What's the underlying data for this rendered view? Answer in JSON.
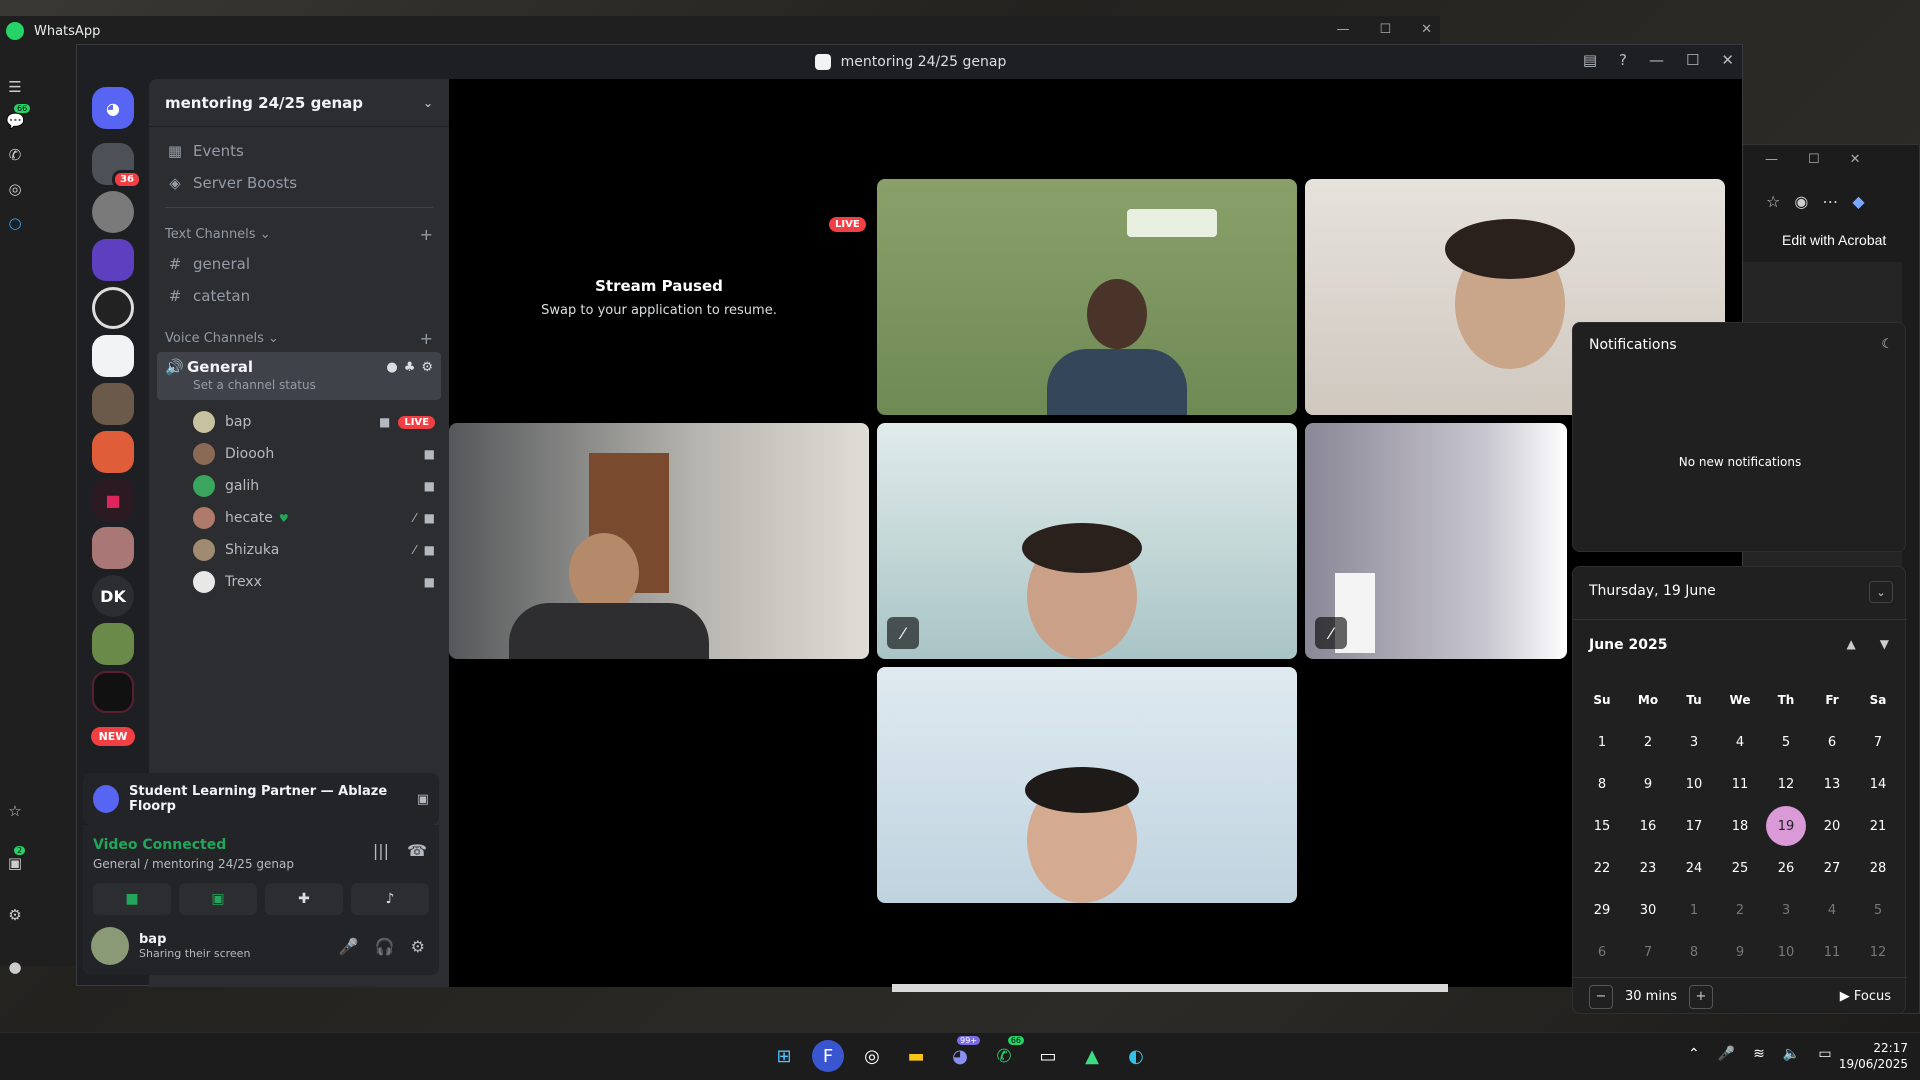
{
  "whatsapp": {
    "title": "WhatsApp",
    "badge_chats": "66",
    "badge_updates": "2"
  },
  "edge": {
    "acrobat_label": "Edit with Acrobat"
  },
  "discord": {
    "window_title": "mentoring 24/25 genap",
    "server_badge": "36",
    "new_label": "NEW",
    "dk_label": "DK",
    "server_name": "mentoring 24/25 genap",
    "nav": [
      {
        "label": "Events"
      },
      {
        "label": "Server Boosts"
      }
    ],
    "text_category": "Text Channels",
    "text_channels": [
      {
        "name": "general"
      },
      {
        "name": "catetan"
      }
    ],
    "voice_category": "Voice Channels",
    "voice_channel": {
      "name": "General",
      "status": "Set a channel status"
    },
    "voice_users": [
      {
        "name": "bap",
        "live": "LIVE",
        "color": "#c9c2a0"
      },
      {
        "name": "Dioooh",
        "color": "#8a6a55"
      },
      {
        "name": "galih",
        "color": "#3aa55d"
      },
      {
        "name": "hecate",
        "color": "#b07a6a"
      },
      {
        "name": "Shizuka",
        "color": "#a08a70"
      },
      {
        "name": "Trexx",
        "color": "#e8e8e8"
      }
    ],
    "activity": "Student Learning Partner — Ablaze Floorp",
    "voice_connected": "Video Connected",
    "voice_location": "General / mentoring 24/25 genap",
    "me_name": "bap",
    "me_status": "Sharing their screen",
    "stream": {
      "title": "Stream Paused",
      "subtitle": "Swap to your application to resume.",
      "live": "LIVE"
    }
  },
  "notifications": {
    "title": "Notifications",
    "empty": "No new notifications"
  },
  "calendar": {
    "date_header": "Thursday, 19 June",
    "month": "June 2025",
    "weekdays": [
      "Su",
      "Mo",
      "Tu",
      "We",
      "Th",
      "Fr",
      "Sa"
    ],
    "days": [
      "1",
      "2",
      "3",
      "4",
      "5",
      "6",
      "7",
      "8",
      "9",
      "10",
      "11",
      "12",
      "13",
      "14",
      "15",
      "16",
      "17",
      "18",
      "19",
      "20",
      "21",
      "22",
      "23",
      "24",
      "25",
      "26",
      "27",
      "28",
      "29",
      "30",
      "1",
      "2",
      "3",
      "4",
      "5",
      "6",
      "7",
      "8",
      "9",
      "10",
      "11",
      "12"
    ],
    "selected": "19",
    "focus_duration": "30 mins",
    "focus_label": "Focus"
  },
  "taskbar": {
    "time": "22:17",
    "date": "19/06/2025",
    "badge_discord": "99+",
    "badge_whatsapp": "66"
  }
}
